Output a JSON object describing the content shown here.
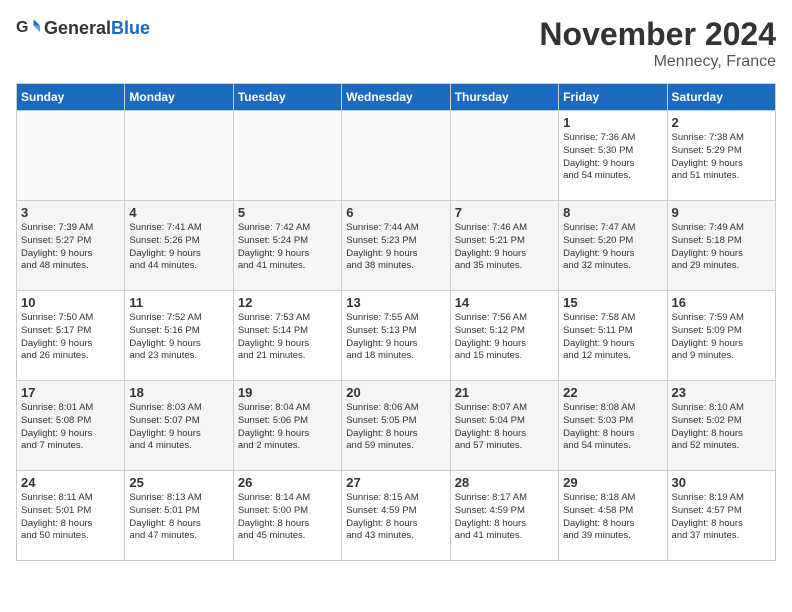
{
  "header": {
    "logo_general": "General",
    "logo_blue": "Blue",
    "month": "November 2024",
    "location": "Mennecy, France"
  },
  "columns": [
    "Sunday",
    "Monday",
    "Tuesday",
    "Wednesday",
    "Thursday",
    "Friday",
    "Saturday"
  ],
  "weeks": [
    {
      "days": [
        {
          "num": "",
          "info": ""
        },
        {
          "num": "",
          "info": ""
        },
        {
          "num": "",
          "info": ""
        },
        {
          "num": "",
          "info": ""
        },
        {
          "num": "",
          "info": ""
        },
        {
          "num": "1",
          "info": "Sunrise: 7:36 AM\nSunset: 5:30 PM\nDaylight: 9 hours\nand 54 minutes."
        },
        {
          "num": "2",
          "info": "Sunrise: 7:38 AM\nSunset: 5:29 PM\nDaylight: 9 hours\nand 51 minutes."
        }
      ]
    },
    {
      "days": [
        {
          "num": "3",
          "info": "Sunrise: 7:39 AM\nSunset: 5:27 PM\nDaylight: 9 hours\nand 48 minutes."
        },
        {
          "num": "4",
          "info": "Sunrise: 7:41 AM\nSunset: 5:26 PM\nDaylight: 9 hours\nand 44 minutes."
        },
        {
          "num": "5",
          "info": "Sunrise: 7:42 AM\nSunset: 5:24 PM\nDaylight: 9 hours\nand 41 minutes."
        },
        {
          "num": "6",
          "info": "Sunrise: 7:44 AM\nSunset: 5:23 PM\nDaylight: 9 hours\nand 38 minutes."
        },
        {
          "num": "7",
          "info": "Sunrise: 7:46 AM\nSunset: 5:21 PM\nDaylight: 9 hours\nand 35 minutes."
        },
        {
          "num": "8",
          "info": "Sunrise: 7:47 AM\nSunset: 5:20 PM\nDaylight: 9 hours\nand 32 minutes."
        },
        {
          "num": "9",
          "info": "Sunrise: 7:49 AM\nSunset: 5:18 PM\nDaylight: 9 hours\nand 29 minutes."
        }
      ]
    },
    {
      "days": [
        {
          "num": "10",
          "info": "Sunrise: 7:50 AM\nSunset: 5:17 PM\nDaylight: 9 hours\nand 26 minutes."
        },
        {
          "num": "11",
          "info": "Sunrise: 7:52 AM\nSunset: 5:16 PM\nDaylight: 9 hours\nand 23 minutes."
        },
        {
          "num": "12",
          "info": "Sunrise: 7:53 AM\nSunset: 5:14 PM\nDaylight: 9 hours\nand 21 minutes."
        },
        {
          "num": "13",
          "info": "Sunrise: 7:55 AM\nSunset: 5:13 PM\nDaylight: 9 hours\nand 18 minutes."
        },
        {
          "num": "14",
          "info": "Sunrise: 7:56 AM\nSunset: 5:12 PM\nDaylight: 9 hours\nand 15 minutes."
        },
        {
          "num": "15",
          "info": "Sunrise: 7:58 AM\nSunset: 5:11 PM\nDaylight: 9 hours\nand 12 minutes."
        },
        {
          "num": "16",
          "info": "Sunrise: 7:59 AM\nSunset: 5:09 PM\nDaylight: 9 hours\nand 9 minutes."
        }
      ]
    },
    {
      "days": [
        {
          "num": "17",
          "info": "Sunrise: 8:01 AM\nSunset: 5:08 PM\nDaylight: 9 hours\nand 7 minutes."
        },
        {
          "num": "18",
          "info": "Sunrise: 8:03 AM\nSunset: 5:07 PM\nDaylight: 9 hours\nand 4 minutes."
        },
        {
          "num": "19",
          "info": "Sunrise: 8:04 AM\nSunset: 5:06 PM\nDaylight: 9 hours\nand 2 minutes."
        },
        {
          "num": "20",
          "info": "Sunrise: 8:06 AM\nSunset: 5:05 PM\nDaylight: 8 hours\nand 59 minutes."
        },
        {
          "num": "21",
          "info": "Sunrise: 8:07 AM\nSunset: 5:04 PM\nDaylight: 8 hours\nand 57 minutes."
        },
        {
          "num": "22",
          "info": "Sunrise: 8:08 AM\nSunset: 5:03 PM\nDaylight: 8 hours\nand 54 minutes."
        },
        {
          "num": "23",
          "info": "Sunrise: 8:10 AM\nSunset: 5:02 PM\nDaylight: 8 hours\nand 52 minutes."
        }
      ]
    },
    {
      "days": [
        {
          "num": "24",
          "info": "Sunrise: 8:11 AM\nSunset: 5:01 PM\nDaylight: 8 hours\nand 50 minutes."
        },
        {
          "num": "25",
          "info": "Sunrise: 8:13 AM\nSunset: 5:01 PM\nDaylight: 8 hours\nand 47 minutes."
        },
        {
          "num": "26",
          "info": "Sunrise: 8:14 AM\nSunset: 5:00 PM\nDaylight: 8 hours\nand 45 minutes."
        },
        {
          "num": "27",
          "info": "Sunrise: 8:15 AM\nSunset: 4:59 PM\nDaylight: 8 hours\nand 43 minutes."
        },
        {
          "num": "28",
          "info": "Sunrise: 8:17 AM\nSunset: 4:59 PM\nDaylight: 8 hours\nand 41 minutes."
        },
        {
          "num": "29",
          "info": "Sunrise: 8:18 AM\nSunset: 4:58 PM\nDaylight: 8 hours\nand 39 minutes."
        },
        {
          "num": "30",
          "info": "Sunrise: 8:19 AM\nSunset: 4:57 PM\nDaylight: 8 hours\nand 37 minutes."
        }
      ]
    }
  ]
}
